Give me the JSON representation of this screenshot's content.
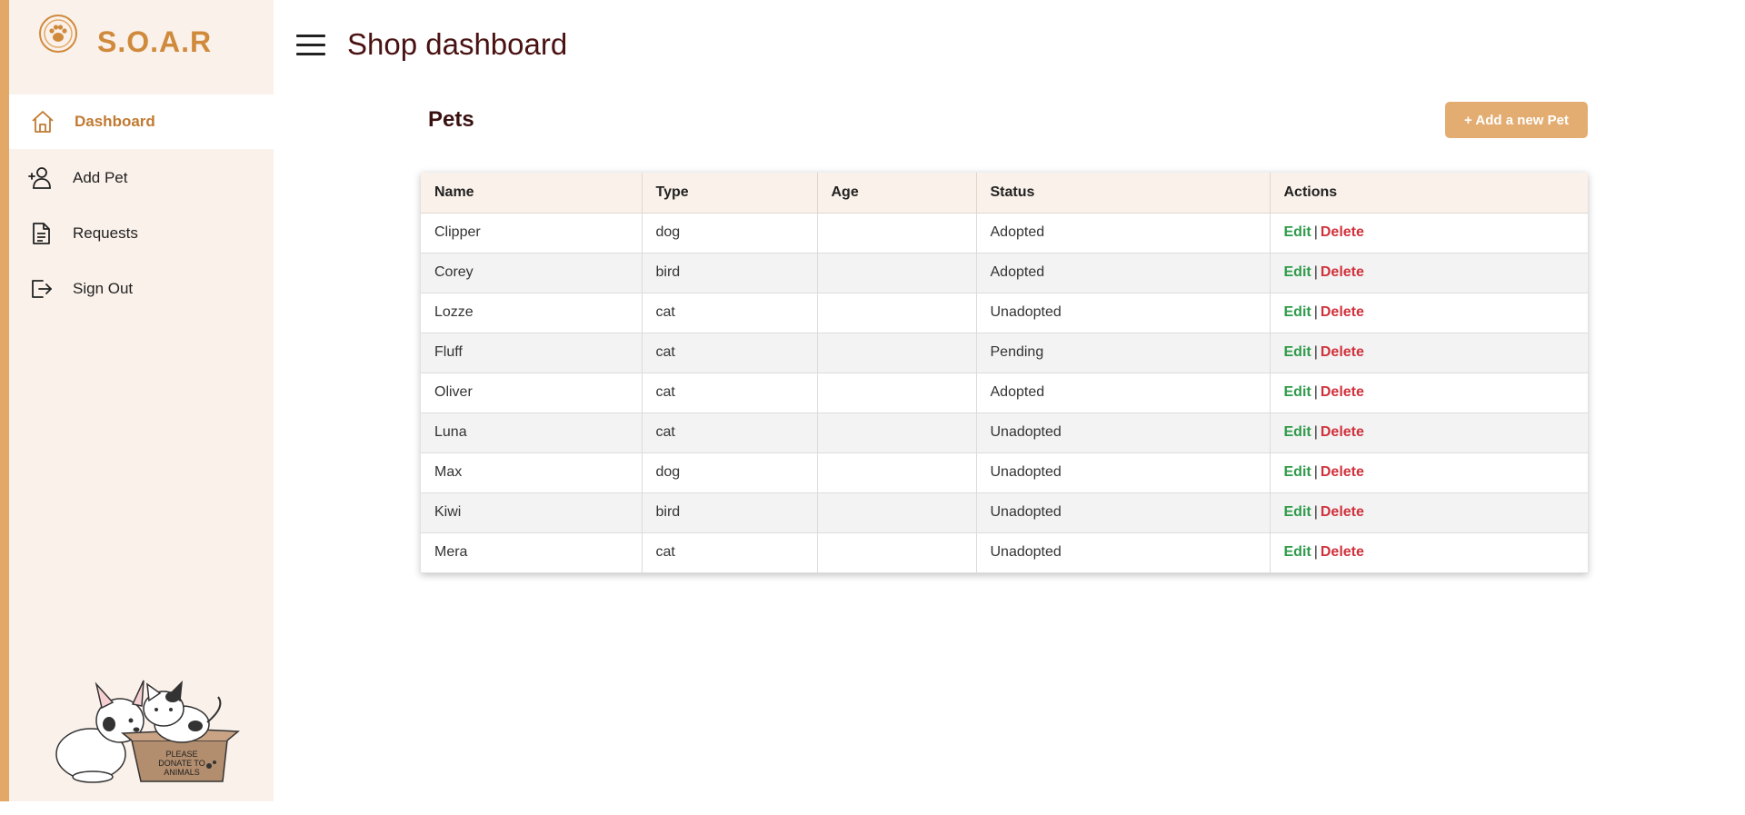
{
  "brand": {
    "name": "S.O.A.R"
  },
  "sidebar": {
    "items": [
      {
        "label": "Dashboard",
        "icon": "home-icon",
        "active": true
      },
      {
        "label": "Add Pet",
        "icon": "user-plus-icon",
        "active": false
      },
      {
        "label": "Requests",
        "icon": "document-icon",
        "active": false
      },
      {
        "label": "Sign Out",
        "icon": "sign-out-icon",
        "active": false
      }
    ],
    "illustration": {
      "box_text": "PLEASE DONATE TO ANIMALS"
    }
  },
  "header": {
    "title": "Shop dashboard",
    "menu_icon": "hamburger-icon"
  },
  "main": {
    "section_title": "Pets",
    "add_button_label": "+ Add a new Pet",
    "table": {
      "columns": [
        "Name",
        "Type",
        "Age",
        "Status",
        "Actions"
      ],
      "rows": [
        {
          "name": "Clipper",
          "type": "dog",
          "age": "",
          "status": "Adopted"
        },
        {
          "name": "Corey",
          "type": "bird",
          "age": "",
          "status": "Adopted"
        },
        {
          "name": "Lozze",
          "type": "cat",
          "age": "",
          "status": "Unadopted"
        },
        {
          "name": "Fluff",
          "type": "cat",
          "age": "",
          "status": "Pending"
        },
        {
          "name": "Oliver",
          "type": "cat",
          "age": "",
          "status": "Adopted"
        },
        {
          "name": "Luna",
          "type": "cat",
          "age": "",
          "status": "Unadopted"
        },
        {
          "name": "Max",
          "type": "dog",
          "age": "",
          "status": "Unadopted"
        },
        {
          "name": "Kiwi",
          "type": "bird",
          "age": "",
          "status": "Unadopted"
        },
        {
          "name": "Mera",
          "type": "cat",
          "age": "",
          "status": "Unadopted"
        }
      ],
      "actions": {
        "edit": "Edit",
        "separator": "|",
        "delete": "Delete"
      }
    }
  },
  "colors": {
    "accent": "#e3a866",
    "brand_text": "#d08a3c",
    "sidebar_bg": "#faf1ea",
    "title": "#4a1212",
    "edit": "#2f9a4a",
    "delete": "#d0323c"
  }
}
